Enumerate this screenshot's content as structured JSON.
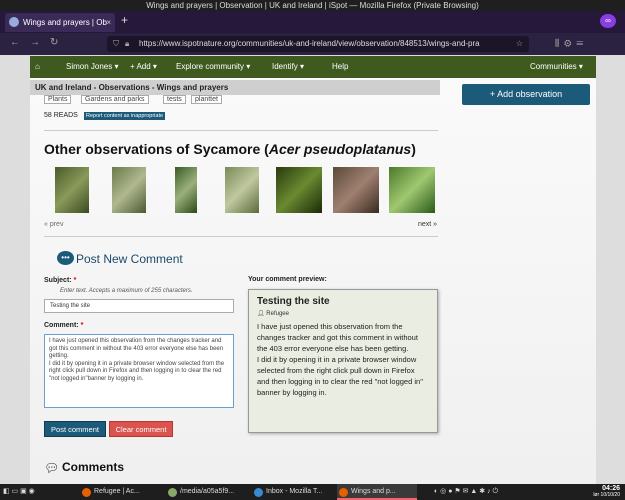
{
  "window": {
    "title": "Wings and prayers | Observation | UK and Ireland | iSpot — Mozilla Firefox (Private Browsing)"
  },
  "browser": {
    "tab_label": "Wings and prayers | Ob",
    "url": "https://www.ispotnature.org/communities/uk-and-ireland/view/observation/848513/wings-and-pra"
  },
  "sitenav": {
    "home": "⌂",
    "user": "Simon Jones ▾",
    "add": "+ Add ▾",
    "explore": "Explore community ▾",
    "identify": "Identify ▾",
    "help": "Help",
    "communities": "Communities ▾"
  },
  "breadcrumb": "UK and Ireland - Observations - Wings and prayers",
  "add_observation": "Add observation",
  "tags": [
    "Plants",
    "Gardens and parks",
    "tests",
    "planttet"
  ],
  "reads": "58 READS",
  "report": "Report content as inappropriate",
  "other": {
    "title_prefix": "Other observations of Sycamore (",
    "title_species": "Acer pseudoplatanus",
    "title_suffix": ")",
    "prev": "« prev",
    "next": "next »"
  },
  "comment_form": {
    "heading": "Post New Comment",
    "subject_label": "Subject:",
    "subject_hint": "Enter text. Accepts a maximum of 255 characters.",
    "subject_value": "Testing the site",
    "comment_label": "Comment:",
    "comment_value": "I have just opened this observation from the changes tracker and got this comment in without the 403 error everyone else has been getting.\nI did it by opening it in a private browser window selected from the right click pull down in Firefox and then logging in to clear the red \"not logged in\"banner by logging in.",
    "post": "Post comment",
    "clear": "Clear comment"
  },
  "preview": {
    "label": "Your comment preview:",
    "title": "Testing the site",
    "user": "Refugee",
    "body": "I have just opened this observation from the changes tracker and got this comment in without the 403 error everyone else has been getting.\nI did it by opening it in a private browser window selected from the right click pull down in Firefox and then logging in to clear the red \"not logged in\" banner by logging in."
  },
  "comments_heading": "Comments",
  "taskbar": {
    "items": [
      "Refugee | Ac...",
      "/media/a05a5f9...",
      "Inbox - Mozilla T...",
      "Wings and p..."
    ],
    "time": "04:26",
    "date": "lør 10/10/20"
  },
  "colors": {
    "nav": "#3e5a1f",
    "accent": "#1c5a7a",
    "clear": "#d9534f"
  }
}
